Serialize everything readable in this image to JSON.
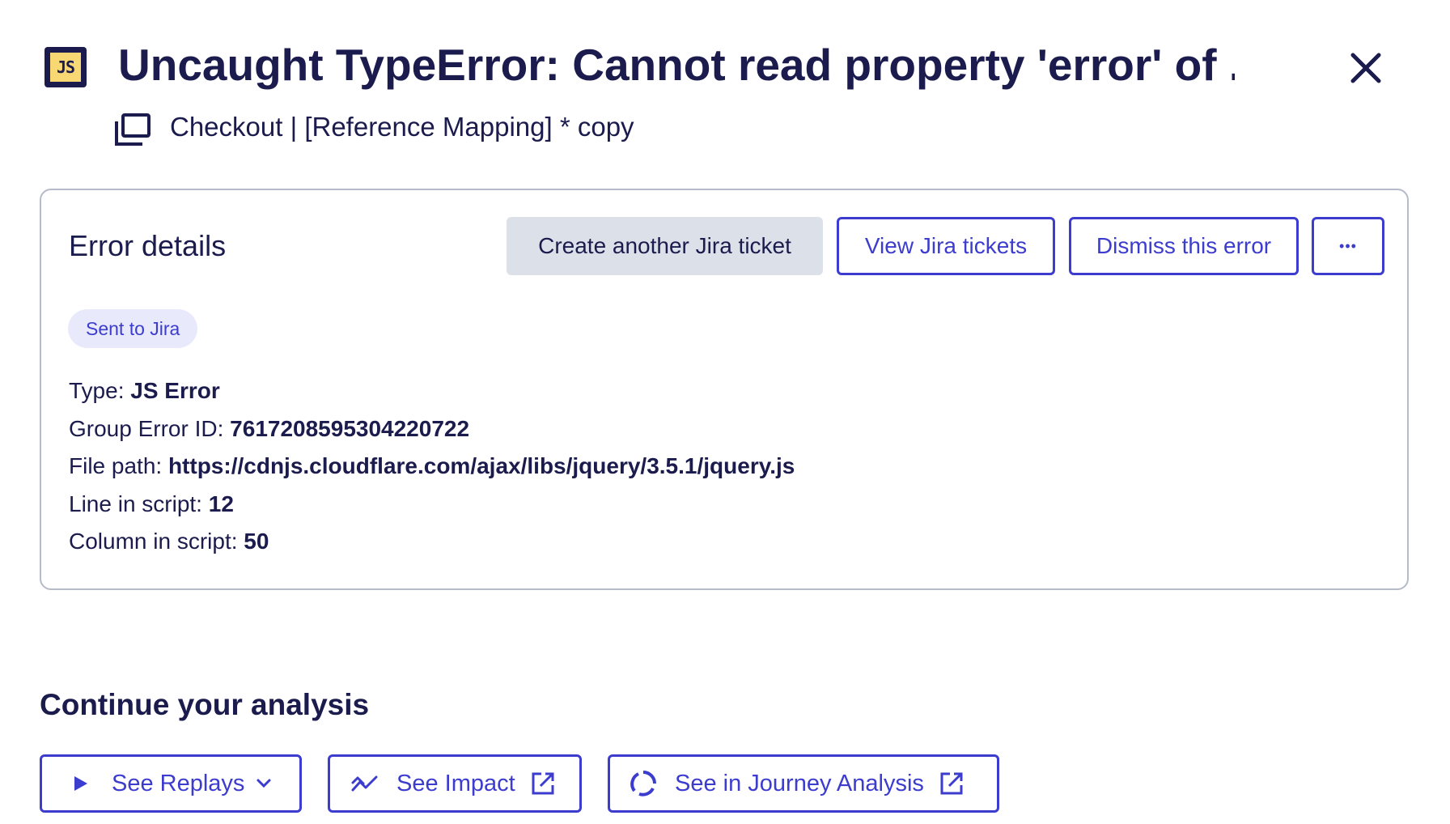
{
  "header": {
    "title": "Uncaught TypeError: Cannot read property 'error' of ...",
    "icon": "js-file-icon",
    "subtitle": "Checkout | [Reference Mapping] * copy",
    "subtitle_icon": "screens-icon",
    "close_icon": "close-icon"
  },
  "card": {
    "title": "Error details",
    "buttons": {
      "create_ticket": "Create another Jira ticket",
      "view_tickets": "View Jira tickets",
      "dismiss": "Dismiss this error",
      "more": "•••"
    },
    "badge": "Sent to Jira",
    "details": [
      {
        "label": "Type: ",
        "value": "JS Error"
      },
      {
        "label": "Group Error ID: ",
        "value": "7617208595304220722"
      },
      {
        "label": "File path: ",
        "value": "https://cdnjs.cloudflare.com/ajax/libs/jquery/3.5.1/jquery.js"
      },
      {
        "label": "Line in script: ",
        "value": "12"
      },
      {
        "label": "Column in script: ",
        "value": "50"
      }
    ]
  },
  "analysis": {
    "title": "Continue your analysis",
    "buttons": {
      "replays": "See Replays",
      "impact": "See Impact",
      "journey": "See in Journey Analysis"
    }
  },
  "colors": {
    "primary": "#3c3ccf",
    "text": "#1b1b4d",
    "js_yellow": "#f7d873",
    "badge_bg": "#e8e9fb",
    "gray_button": "#dce1e9",
    "card_border": "#b5bbc9"
  }
}
